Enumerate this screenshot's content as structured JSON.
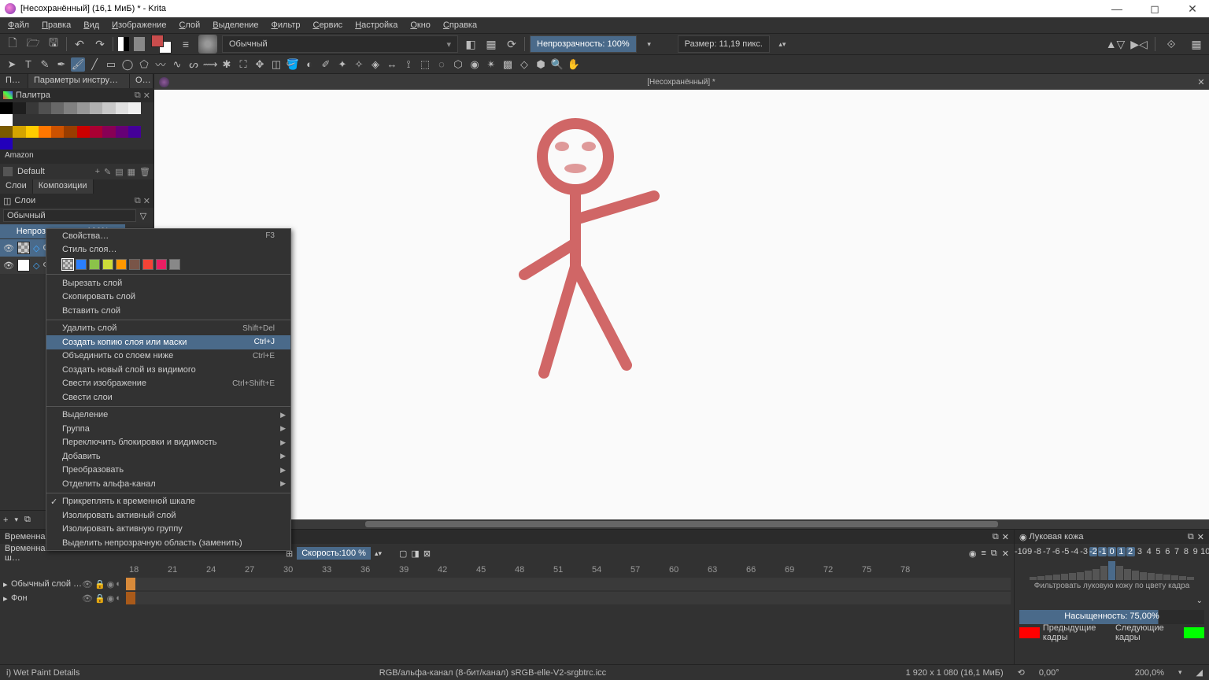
{
  "window": {
    "title": "[Несохранённый] (16,1 МиБ) * - Krita",
    "document_tab": "[Несохранённый] *"
  },
  "menubar": [
    "Файл",
    "Правка",
    "Вид",
    "Изображение",
    "Слой",
    "Выделение",
    "Фильтр",
    "Сервис",
    "Настройка",
    "Окно",
    "Справка"
  ],
  "toolbar1": {
    "blending_mode": "Обычный",
    "opacity": "Непрозрачность: 100%",
    "size": "Размер: 11,19 пикс."
  },
  "left_panel": {
    "tabs": [
      "Пал…",
      "Параметры инструме…",
      "Об…"
    ],
    "palette_title": "Палитра",
    "palette_grays": [
      "#000000",
      "#1e1e1e",
      "#383838",
      "#505050",
      "#686868",
      "#808080",
      "#989898",
      "#b0b0b0",
      "#c8c8c8",
      "#e0e0e0",
      "#f0f0f0",
      "#ffffff"
    ],
    "palette_colors": [
      "#7a5a00",
      "#d4a400",
      "#ffcc00",
      "#ff7700",
      "#cc5200",
      "#993d00",
      "#cc0000",
      "#aa0033",
      "#880055",
      "#660077",
      "#440099",
      "#2200bb"
    ],
    "palette_name": "Amazon",
    "palette_set": "Default",
    "layer_tabs": [
      "Слои",
      "Композиции"
    ],
    "layers_title": "Слои",
    "blend_mode": "Обычный",
    "layer_opacity": "Непрозрачность: 100%",
    "layers": [
      {
        "name": "О…",
        "selected": true,
        "thumb": "checker"
      },
      {
        "name": "Ф…",
        "selected": false,
        "thumb": "white"
      }
    ]
  },
  "context_menu": {
    "items": [
      {
        "label": "Свойства…",
        "shortcut": "F3"
      },
      {
        "label": "Стиль слоя…"
      },
      {
        "type": "colors",
        "colors": [
          "#ffffff00",
          "#2a7fff",
          "#8bc34a",
          "#cddc39",
          "#ff9800",
          "#795548",
          "#f44336",
          "#e91e63",
          "#888888"
        ]
      },
      {
        "type": "sep"
      },
      {
        "label": "Вырезать слой"
      },
      {
        "label": "Скопировать слой"
      },
      {
        "label": "Вставить слой"
      },
      {
        "type": "sep"
      },
      {
        "label": "Удалить слой",
        "shortcut": "Shift+Del"
      },
      {
        "label": "Создать копию слоя или маски",
        "shortcut": "Ctrl+J",
        "highlighted": true
      },
      {
        "label": "Объединить со слоем ниже",
        "shortcut": "Ctrl+E"
      },
      {
        "label": "Создать новый слой из видимого"
      },
      {
        "label": "Свести изображение",
        "shortcut": "Ctrl+Shift+E"
      },
      {
        "label": "Свести слои"
      },
      {
        "type": "sep"
      },
      {
        "label": "Выделение",
        "submenu": true
      },
      {
        "label": "Группа",
        "submenu": true
      },
      {
        "label": "Переключить блокировки и видимость",
        "submenu": true
      },
      {
        "label": "Добавить",
        "submenu": true
      },
      {
        "label": "Преобразовать",
        "submenu": true
      },
      {
        "label": "Отделить альфа-канал",
        "submenu": true
      },
      {
        "type": "sep"
      },
      {
        "label": "Прикреплять к временной шкале",
        "checked": true
      },
      {
        "label": "Изолировать активный слой"
      },
      {
        "label": "Изолировать активную группу"
      },
      {
        "label": "Выделить непрозрачную область (заменить)"
      }
    ]
  },
  "timeline": {
    "header_left": "Временная ш…",
    "header_left2": "Временная ш…",
    "speed": "Скорость:100 %",
    "frames": [
      "18",
      "21",
      "24",
      "27",
      "30",
      "33",
      "36",
      "39",
      "42",
      "45",
      "48",
      "51",
      "54",
      "57",
      "60",
      "63",
      "66",
      "69",
      "72",
      "75",
      "78"
    ],
    "tracks": [
      {
        "name": "Обычный слой …"
      },
      {
        "name": "Фон"
      }
    ],
    "onion": {
      "title": "Луковая кожа",
      "nums": [
        "-10",
        "-9",
        "-8",
        "-7",
        "-6",
        "-5",
        "-4",
        "-3",
        "-2",
        "-1",
        "0",
        "1",
        "2",
        "3",
        "4",
        "5",
        "6",
        "7",
        "8",
        "9",
        "10"
      ],
      "filter": "Фильтровать луковую кожу по цвету кадра",
      "saturation": "Насыщенность: 75,00%",
      "prev": "Предыдущие кадры",
      "next": "Следующие кадры"
    }
  },
  "statusbar": {
    "info": "i) Wet Paint Details",
    "color": "RGB/альфа-канал (8-бит/канал)  sRGB-elle-V2-srgbtrc.icc",
    "dim": "1 920 x 1 080 (16,1 МиБ)",
    "angle": "0,00°",
    "zoom": "200,0%"
  }
}
